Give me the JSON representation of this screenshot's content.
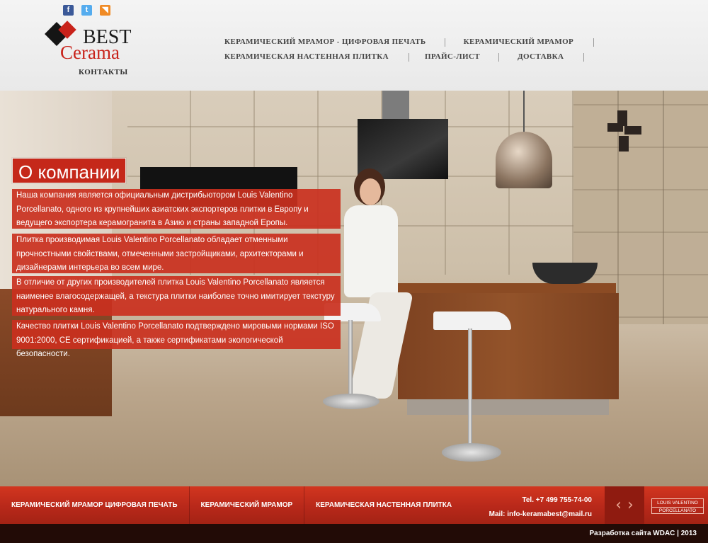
{
  "social": {
    "facebook": "f",
    "twitter": "t",
    "rss": "◥"
  },
  "logo": {
    "line1": "BEST",
    "line2": "Cerama"
  },
  "header": {
    "contacts": "КОНТАКТЫ"
  },
  "nav": {
    "row1": [
      "КЕРАМИЧЕСКИЙ МРАМОР - ЦИФРОВАЯ ПЕЧАТЬ",
      "КЕРАМИЧЕСКИЙ МРАМОР"
    ],
    "row2": [
      "КЕРАМИЧЕСКАЯ НАСТЕННАЯ ПЛИТКА",
      "ПРАЙС-ЛИСТ",
      "ДОСТАВКА"
    ]
  },
  "about": {
    "title": "О компании",
    "paragraphs": [
      "Наша компания является официальным дистрибьютором Louis Valentino Porcellanato, одного из крупнейших азиатских экспортеров плитки в Европу и ведущего экспортера керамогранита в Азию и страны западной Еропы.",
      "Плитка производимая Louis Valentino Porcellanato обладает отменными прочностными свойствами, отмеченными застройщиками, архитекторами и дизайнерами интерьера во всем мире.",
      "В отличие от других производителей плитка Louis Valentino Porcellanato является наименее влагосодержащей, а текстура плитки наиболее точно имитирует текстуру натурального камня.",
      "Качество плитки Louis Valentino Porcellanato подтверждено мировыми нормами ISO 9001:2000, CE сертификацией, а также сертификатами экологической безопасности."
    ]
  },
  "footer": {
    "nav": [
      "КЕРАМИЧЕСКИЙ МРАМОР ЦИФРОВАЯ ПЕЧАТЬ",
      "КЕРАМИЧЕСКИЙ МРАМОР",
      "КЕРАМИЧЕСКАЯ НАСТЕННАЯ ПЛИТКА"
    ],
    "tel": "Tel. +7 499 755-74-00",
    "mail": "Mail: info-keramabest@mail.ru",
    "arrow_prev": "‹",
    "arrow_next": "›",
    "brand_line1": "LOUIS VALENTINO",
    "brand_line2": "PORCELLANATO",
    "credits": "Разработка сайта WDAC  |  2013"
  },
  "colors": {
    "accent": "#c5281a",
    "footer": "#b8281a",
    "brand_dark": "#151515"
  }
}
